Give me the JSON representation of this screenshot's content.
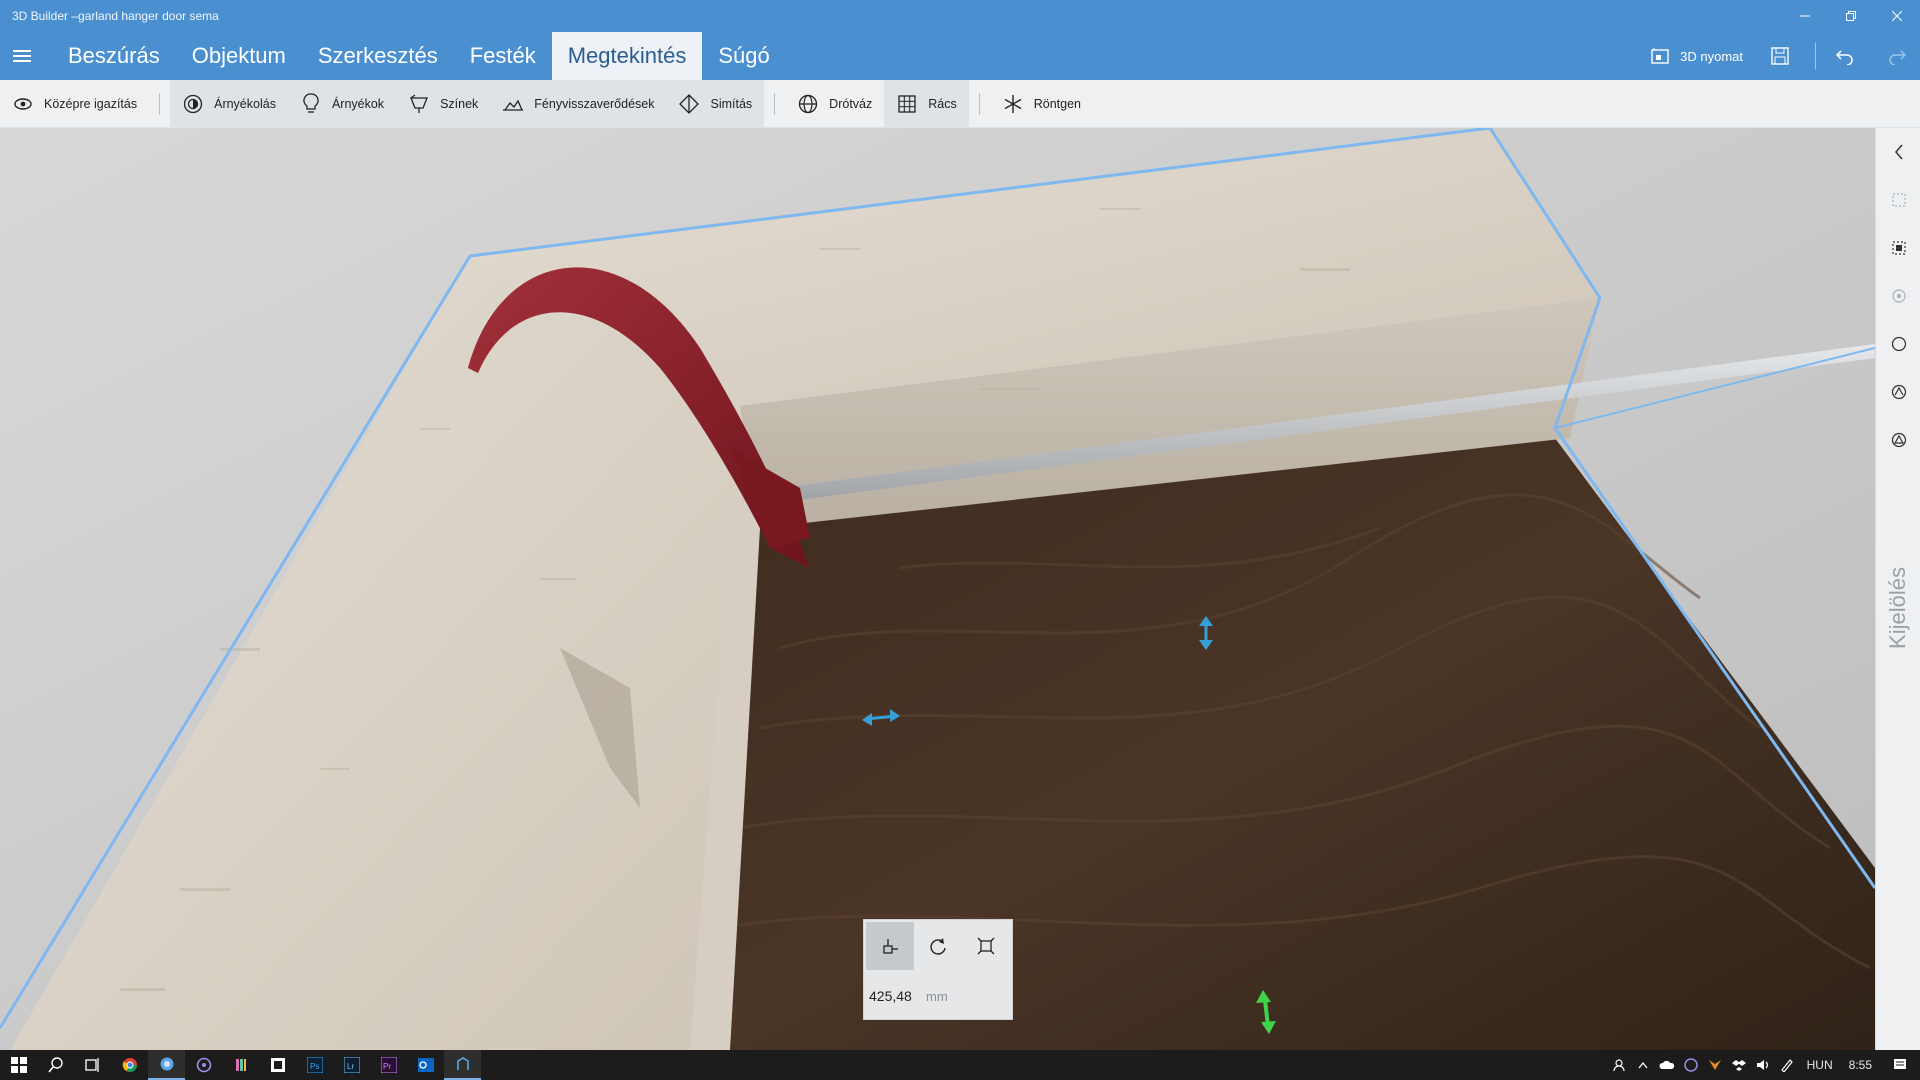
{
  "window": {
    "title": "3D Builder –garland hanger door sema",
    "controls": [
      "minimize",
      "restore",
      "close"
    ]
  },
  "tabs": [
    {
      "label": "Beszúrás",
      "active": false
    },
    {
      "label": "Objektum",
      "active": false
    },
    {
      "label": "Szerkesztés",
      "active": false
    },
    {
      "label": "Festék",
      "active": false
    },
    {
      "label": "Megtekintés",
      "active": true
    },
    {
      "label": "Súgó",
      "active": false
    }
  ],
  "right_actions": {
    "print_label": "3D nyomat",
    "print_icon": "print3d-icon",
    "save_icon": "save-icon",
    "undo_icon": "undo-icon",
    "redo_icon": "redo-icon"
  },
  "ribbon": {
    "center": "Középre igazítás",
    "shading": "Árnyékolás",
    "shadows": "Árnyékok",
    "colors": "Színek",
    "reflections": "Fényvisszaverődések",
    "smoothing": "Simítás",
    "wireframe": "Drótváz",
    "grid": "Rács",
    "xray": "Röntgen"
  },
  "sidepanel": {
    "label": "Kijelölés",
    "icons": [
      "chevron-left-icon",
      "select-objects-icon",
      "select-mesh-icon",
      "select-faces-icon",
      "circle-select-icon",
      "select-edges-icon",
      "select-vertices-icon"
    ]
  },
  "transform": {
    "value": "425,48",
    "unit": "mm",
    "modes": [
      "move",
      "rotate",
      "scale"
    ],
    "active_mode": "move"
  },
  "taskbar": {
    "lang": "HUN",
    "time": "8:55",
    "apps": [
      "start",
      "search",
      "task-view",
      "chrome",
      "app",
      "viber",
      "app2",
      "app3",
      "photoshop",
      "lightroom",
      "premiere",
      "outlook",
      "3d-builder"
    ]
  },
  "colors": {
    "accent": "#4a8fcf",
    "selection_outline": "#7fb8f0",
    "hook": "#8a1d25",
    "door": "#3b2a1e"
  }
}
